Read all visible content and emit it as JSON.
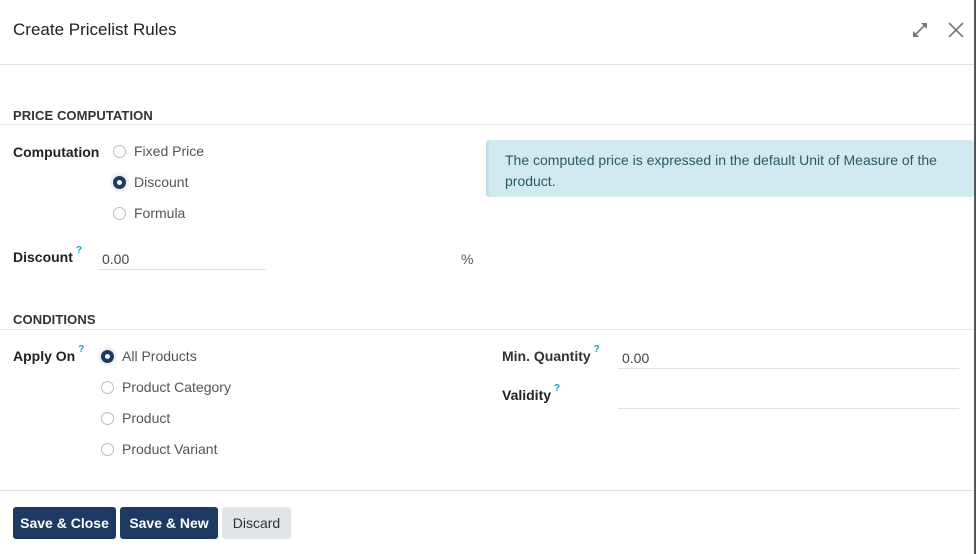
{
  "dialog": {
    "title": "Create Pricelist Rules",
    "expand_icon": "expand-arrows-icon",
    "close_icon": "close-x-icon"
  },
  "price_computation": {
    "section_title": "PRICE COMPUTATION",
    "computation_label": "Computation",
    "options": [
      {
        "label": "Fixed Price",
        "checked": false
      },
      {
        "label": "Discount",
        "checked": true
      },
      {
        "label": "Formula",
        "checked": false
      }
    ],
    "discount_label": "Discount",
    "discount_help": "?",
    "discount_value": "0.00",
    "discount_unit": "%",
    "info_alert": "The computed price is expressed in the default Unit of Measure of the product."
  },
  "conditions": {
    "section_title": "CONDITIONS",
    "apply_on_label": "Apply On",
    "apply_on_help": "?",
    "options": [
      {
        "label": "All Products",
        "checked": true
      },
      {
        "label": "Product Category",
        "checked": false
      },
      {
        "label": "Product",
        "checked": false
      },
      {
        "label": "Product Variant",
        "checked": false
      }
    ],
    "min_quantity_label": "Min. Quantity",
    "min_quantity_help": "?",
    "min_quantity_value": "0.00",
    "validity_label": "Validity",
    "validity_help": "?",
    "validity_value": ""
  },
  "footer": {
    "save_close": "Save & Close",
    "save_new": "Save & New",
    "discard": "Discard"
  },
  "colors": {
    "primary": "#1d3a63",
    "info_bg": "#d1eaef",
    "help": "#17a2b8"
  }
}
